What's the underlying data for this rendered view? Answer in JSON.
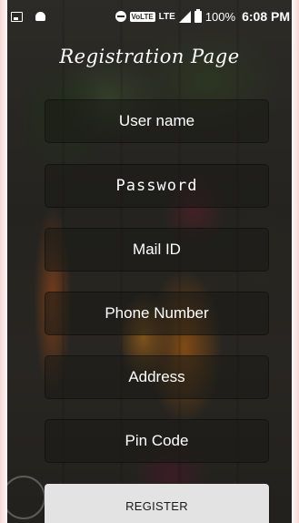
{
  "status_bar": {
    "left_icons": [
      "image-icon",
      "android-icon"
    ],
    "right_icons": [
      "do-not-disturb-icon",
      "volte-icon",
      "lte-icon",
      "signal-icon",
      "battery-icon"
    ],
    "volte_label": "VoLTE",
    "lte_label": "LTE",
    "battery_percent": "100%",
    "time": "6:08 PM"
  },
  "page": {
    "title": "Registration Page"
  },
  "form": {
    "username_placeholder": "User name",
    "password_placeholder": "Password",
    "mail_placeholder": "Mail ID",
    "phone_placeholder": "Phone Number",
    "address_placeholder": "Address",
    "pincode_placeholder": "Pin Code",
    "register_label": "REGISTER"
  },
  "colors": {
    "text": "#ffffff",
    "field_bg": "rgba(25,25,22,0.55)",
    "button_bg": "#e3e3e3",
    "button_text": "#1a1a1a"
  }
}
